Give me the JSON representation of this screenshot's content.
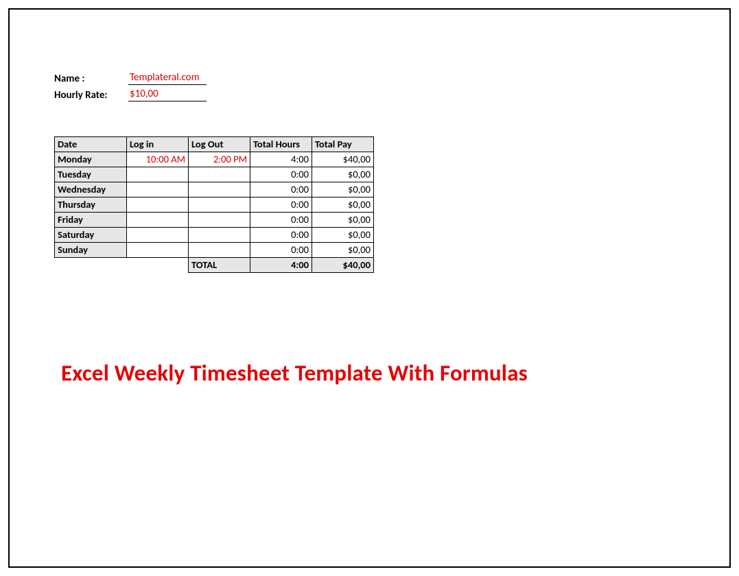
{
  "header": {
    "name_label": "Name :",
    "name_value": "Templateral.com",
    "rate_label": "Hourly Rate:",
    "rate_value": "$10,00"
  },
  "columns": {
    "date": "Date",
    "login": "Log in",
    "logout": "Log Out",
    "hours": "Total Hours",
    "pay": "Total Pay"
  },
  "rows": [
    {
      "day": "Monday",
      "login": "10:00 AM",
      "logout": "2:00 PM",
      "hours": "4:00",
      "pay": "$40,00"
    },
    {
      "day": "Tuesday",
      "login": "",
      "logout": "",
      "hours": "0:00",
      "pay": "$0,00"
    },
    {
      "day": "Wednesday",
      "login": "",
      "logout": "",
      "hours": "0:00",
      "pay": "$0,00"
    },
    {
      "day": "Thursday",
      "login": "",
      "logout": "",
      "hours": "0:00",
      "pay": "$0,00"
    },
    {
      "day": "Friday",
      "login": "",
      "logout": "",
      "hours": "0:00",
      "pay": "$0,00"
    },
    {
      "day": "Saturday",
      "login": "",
      "logout": "",
      "hours": "0:00",
      "pay": "$0,00"
    },
    {
      "day": "Sunday",
      "login": "",
      "logout": "",
      "hours": "0:00",
      "pay": "$0,00"
    }
  ],
  "footer": {
    "label": "TOTAL",
    "hours": "4:00",
    "pay": "$40,00"
  },
  "title": "Excel Weekly Timesheet Template With Formulas"
}
